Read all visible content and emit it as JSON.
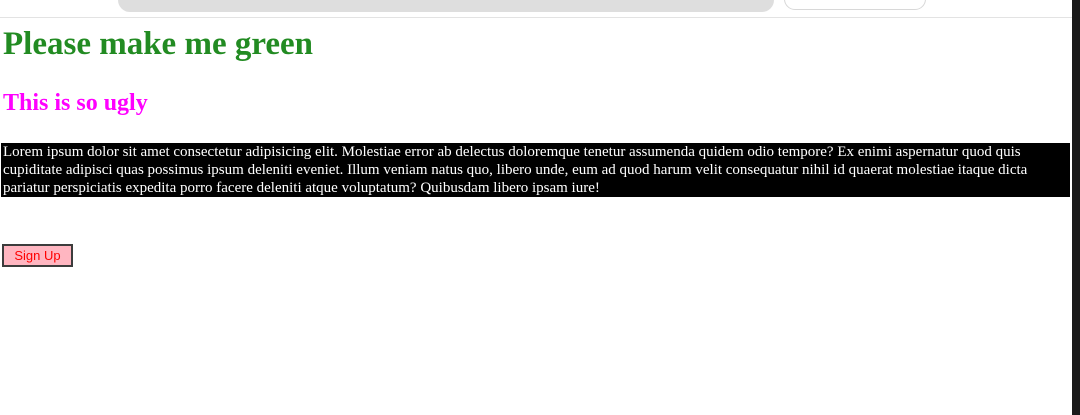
{
  "page": {
    "heading1": "Please make me green",
    "heading2": "This is so ugly",
    "paragraph": "Lorem ipsum dolor sit amet consectetur adipisicing elit. Molestiae error ab delectus doloremque tenetur assumenda quidem odio tempore? Ex enimi aspernatur quod quis cupiditate adipisci quas possimus ipsum deleniti eveniet. Illum veniam natus quo, libero unde, eum ad quod harum velit consequatur nihil id quaerat molestiae itaque dicta pariatur perspiciatis expedita porro facere deleniti atque voluptatum? Quibusdam libero ipsam iure!",
    "button_label": "Sign Up"
  },
  "colors": {
    "heading1": "#228b22",
    "heading2": "#ff00ff",
    "paragraph_bg": "#000000",
    "paragraph_text": "#ffffff",
    "button_bg": "#ffb6c1",
    "button_text": "#ff0000"
  },
  "icons": {
    "back": "back-arrow-icon"
  }
}
